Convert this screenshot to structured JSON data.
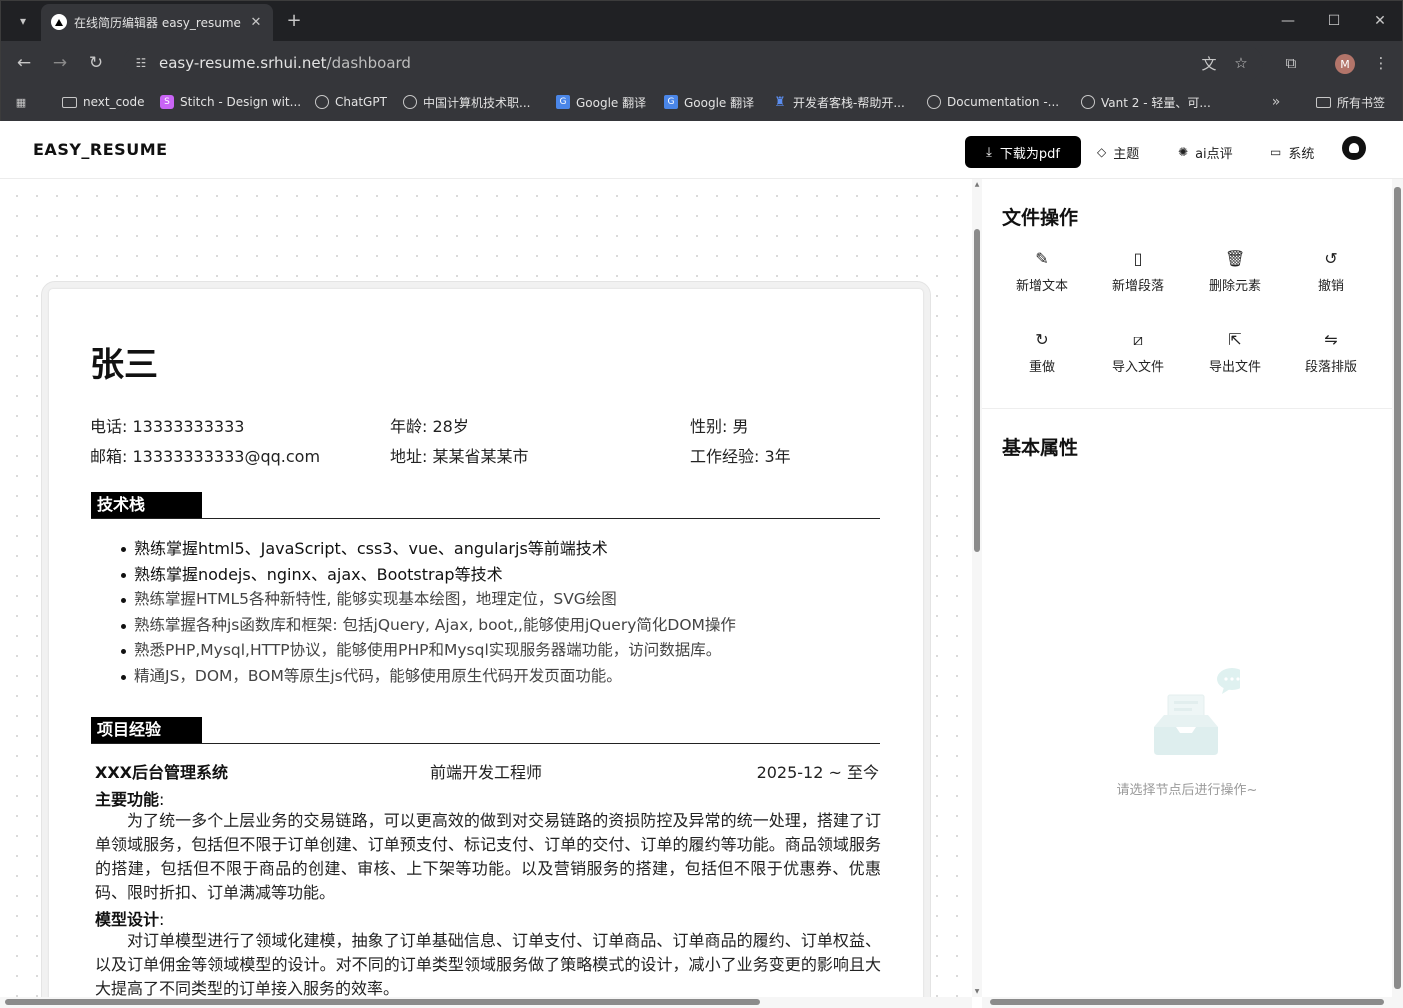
{
  "browser": {
    "tab_title": "在线简历编辑器 easy_resume",
    "url_host": "easy-resume.srhui.net",
    "url_path": "/dashboard",
    "avatar_letter": "M",
    "bookmarks": [
      {
        "label": "next_code",
        "icon": "folder-icon"
      },
      {
        "label": "Stitch - Design wit...",
        "icon": "stitch-icon"
      },
      {
        "label": "ChatGPT",
        "icon": "chatgpt-icon"
      },
      {
        "label": "中国计算机技术职...",
        "icon": "globe-icon"
      },
      {
        "label": "Google 翻译",
        "icon": "google-translate-icon"
      },
      {
        "label": "Google 翻译",
        "icon": "google-translate-icon"
      },
      {
        "label": "开发者客栈-帮助开...",
        "icon": "devkz-icon"
      },
      {
        "label": "Documentation -...",
        "icon": "globe-icon"
      },
      {
        "label": "Vant 2 - 轻量、可...",
        "icon": "globe-icon"
      }
    ],
    "all_bookmarks": "所有书签"
  },
  "header": {
    "logo": "EASY_RESUME",
    "download_pdf": "下载为pdf",
    "theme": "主题",
    "ai_review": "ai点评",
    "system": "系统"
  },
  "resume": {
    "name": "张三",
    "info": {
      "phone": "电话: 13333333333",
      "age": "年龄: 28岁",
      "gender": "性别: 男",
      "email": "邮箱: 13333333333@qq.com",
      "address": "地址: 某某省某某市",
      "experience": "工作经验: 3年"
    },
    "skills_title": "技术栈",
    "skills": [
      "熟练掌握html5、JavaScript、css3、vue、angularjs等前端技术",
      "熟练掌握nodejs、nginx、ajax、Bootstrap等技术",
      "熟练掌握HTML5各种新特性, 能够实现基本绘图，地理定位，SVG绘图",
      "熟练掌握各种js函数库和框架: 包括jQuery, Ajax, boot,,能够使用jQuery简化DOM操作",
      "熟悉PHP,Mysql,HTTP协议，能够使用PHP和Mysql实现服务器端功能，访问数据库。",
      "精通JS，DOM，BOM等原生js代码，能够使用原生代码开发页面功能。"
    ],
    "projects_title": "项目经验",
    "project": {
      "name": "XXX后台管理系统",
      "role": "前端开发工程师",
      "date": "2025-12 ~ 至今",
      "main_label": "主要功能",
      "colon": ":",
      "main_text": "为了统一多个上层业务的交易链路，可以更高效的做到对交易链路的资损防控及异常的统一处理，搭建了订单领域服务，包括但不限于订单创建、订单预支付、标记支付、订单的交付、订单的履约等功能。商品领域服务的搭建，包括但不限于商品的创建、审核、上下架等功能。以及营销服务的搭建，包括但不限于优惠券、优惠码、限时折扣、订单满减等功能。",
      "model_label": "模型设计",
      "model_text": "对订单模型进行了领域化建模，抽象了订单基础信息、订单支付、订单商品、订单商品的履约、订单权益、以及订单佣金等领域模型的设计。对不同的订单类型领域服务做了策略模式的设计，减小了业务变更的影响且大大提高了不同类型的订单接入服务的效率。"
    }
  },
  "panel": {
    "file_ops_title": "文件操作",
    "ops": [
      {
        "label": "新增文本",
        "icon": "add-text-icon"
      },
      {
        "label": "新增段落",
        "icon": "add-paragraph-icon"
      },
      {
        "label": "删除元素",
        "icon": "trash-icon"
      },
      {
        "label": "撤销",
        "icon": "undo-icon"
      },
      {
        "label": "重做",
        "icon": "redo-icon"
      },
      {
        "label": "导入文件",
        "icon": "import-icon"
      },
      {
        "label": "导出文件",
        "icon": "export-icon"
      },
      {
        "label": "段落排版",
        "icon": "layout-icon"
      }
    ],
    "props_title": "基本属性",
    "empty_text": "请选择节点后进行操作~"
  }
}
